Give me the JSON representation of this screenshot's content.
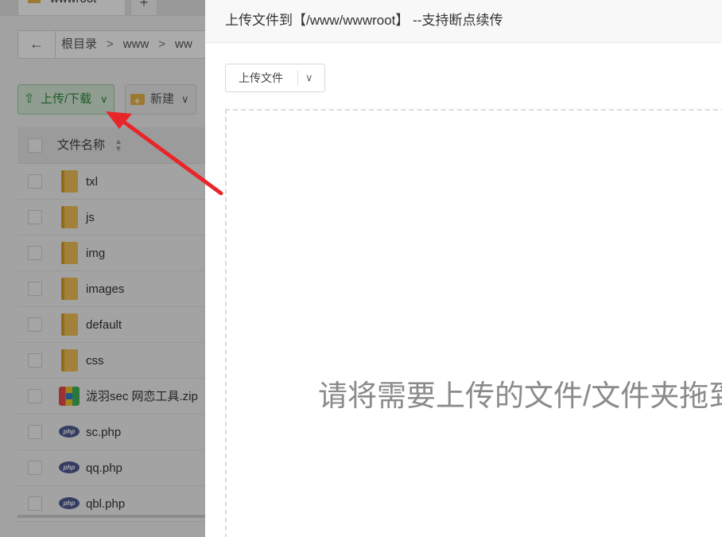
{
  "tabbar": {
    "tab_label": "wwwroot",
    "tab_close": "×",
    "tab_add": "+"
  },
  "pathbar": {
    "back_glyph": "←",
    "crumbs": [
      "根目录",
      "www",
      "ww"
    ],
    "sep": ">"
  },
  "toolbar": {
    "upload_download_label": "上传/下载",
    "new_label": "新建",
    "chevron": "∨"
  },
  "table": {
    "header_name": "文件名称",
    "rows": [
      {
        "name": "txl",
        "type": "folder"
      },
      {
        "name": "js",
        "type": "folder"
      },
      {
        "name": "img",
        "type": "folder"
      },
      {
        "name": "images",
        "type": "folder"
      },
      {
        "name": "default",
        "type": "folder"
      },
      {
        "name": "css",
        "type": "folder"
      },
      {
        "name": "泷羽sec 网恋工具.zip",
        "type": "zip"
      },
      {
        "name": "sc.php",
        "type": "php"
      },
      {
        "name": "qq.php",
        "type": "php"
      },
      {
        "name": "qbl.php",
        "type": "php"
      }
    ],
    "php_badge": "php"
  },
  "modal": {
    "title": "上传文件到【/www/wwwroot】 --支持断点续传",
    "upload_select_label": "上传文件",
    "drop_hint": "请将需要上传的文件/文件夹拖到此处"
  },
  "annotation": {
    "arrow_color": "#e8262a"
  },
  "colors": {
    "overlay": "#7f7f7f",
    "accent_green": "#2d8a3b"
  }
}
